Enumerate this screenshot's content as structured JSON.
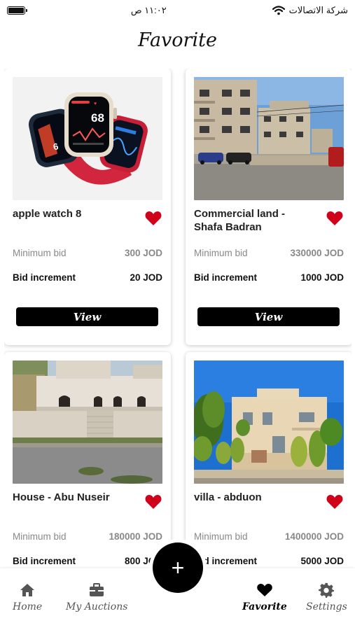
{
  "status_bar": {
    "time": "١١:٠٢ ص",
    "carrier": "شركة الاتصالات"
  },
  "page_title": "Favorite",
  "items": [
    {
      "title": "apple watch 8",
      "min_bid_label": "Minimum bid",
      "min_bid_value": "300 JOD",
      "increment_label": "Bid increment",
      "increment_value": "20 JOD",
      "view_label": "View",
      "favorited": true,
      "watch_screen_text": "68"
    },
    {
      "title": "Commercial land - Shafa Badran",
      "min_bid_label": "Minimum bid",
      "min_bid_value": "330000 JOD",
      "increment_label": "Bid increment",
      "increment_value": "1000 JOD",
      "view_label": "View",
      "favorited": true
    },
    {
      "title": "House - Abu Nuseir",
      "min_bid_label": "Minimum bid",
      "min_bid_value": "180000 JOD",
      "increment_label": "Bid increment",
      "increment_value": "800 JOD",
      "favorited": true
    },
    {
      "title": "villa - abduon",
      "min_bid_label": "Minimum bid",
      "min_bid_value": "1400000 JOD",
      "increment_label": "Bid increment",
      "increment_value": "5000 JOD",
      "favorited": true
    }
  ],
  "fab": {
    "label": "+"
  },
  "tabs": [
    {
      "label": "Home",
      "icon": "home-icon",
      "active": false
    },
    {
      "label": "My Auctions",
      "icon": "briefcase-icon",
      "active": false
    },
    {
      "label": "Favorite",
      "icon": "heart-icon",
      "active": true
    },
    {
      "label": "Settings",
      "icon": "gear-icon",
      "active": false
    }
  ],
  "colors": {
    "heart": "#d0021b",
    "button": "#000000",
    "muted_text": "#888888"
  }
}
